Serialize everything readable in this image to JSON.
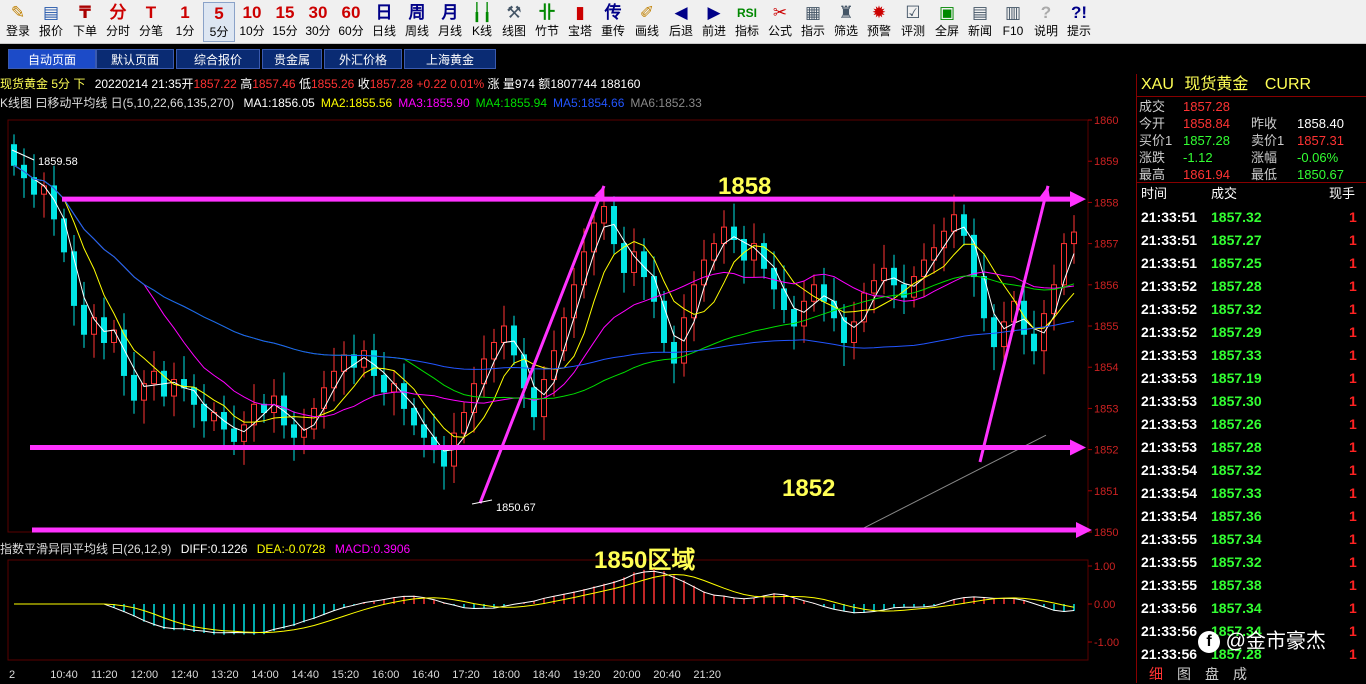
{
  "toolbar": [
    {
      "label": "登录",
      "icon": "login-icon",
      "glyph": "✎",
      "color": "#c08000"
    },
    {
      "label": "报价",
      "icon": "quote-icon",
      "glyph": "▤",
      "color": "#2255aa"
    },
    {
      "label": "下单",
      "icon": "order-icon",
      "glyph": "₸",
      "color": "#aa0000"
    },
    {
      "label": "分时",
      "icon": "timeshare-icon",
      "glyph": "分",
      "color": "#cc0000"
    },
    {
      "label": "分笔",
      "icon": "tick-icon",
      "glyph": "T",
      "color": "#cc0000"
    },
    {
      "label": "1分",
      "icon": "period-1m-icon",
      "glyph": "1",
      "color": "#cc0000"
    },
    {
      "label": "5分",
      "icon": "period-5m-icon",
      "glyph": "5",
      "color": "#cc0000"
    },
    {
      "label": "10分",
      "icon": "period-10m-icon",
      "glyph": "10",
      "color": "#cc0000"
    },
    {
      "label": "15分",
      "icon": "period-15m-icon",
      "glyph": "15",
      "color": "#cc0000"
    },
    {
      "label": "30分",
      "icon": "period-30m-icon",
      "glyph": "30",
      "color": "#cc0000"
    },
    {
      "label": "60分",
      "icon": "period-60m-icon",
      "glyph": "60",
      "color": "#cc0000"
    },
    {
      "label": "日线",
      "icon": "daily-icon",
      "glyph": "日",
      "color": "#000088"
    },
    {
      "label": "周线",
      "icon": "weekly-icon",
      "glyph": "周",
      "color": "#000088"
    },
    {
      "label": "月线",
      "icon": "monthly-icon",
      "glyph": "月",
      "color": "#000088"
    },
    {
      "label": "K线",
      "icon": "kline-icon",
      "glyph": "╽╽",
      "color": "#008800"
    },
    {
      "label": "线图",
      "icon": "line-chart-icon",
      "glyph": "⚒",
      "color": "#445566"
    },
    {
      "label": "竹节",
      "icon": "bamboo-icon",
      "glyph": "卝",
      "color": "#008800"
    },
    {
      "label": "宝塔",
      "icon": "pagoda-icon",
      "glyph": "▮",
      "color": "#cc0000"
    },
    {
      "label": "重传",
      "icon": "resend-icon",
      "glyph": "传",
      "color": "#000088"
    },
    {
      "label": "画线",
      "icon": "draw-line-icon",
      "glyph": "✐",
      "color": "#c08000"
    },
    {
      "label": "后退",
      "icon": "back-icon",
      "glyph": "◀",
      "color": "#000088"
    },
    {
      "label": "前进",
      "icon": "forward-icon",
      "glyph": "▶",
      "color": "#000088"
    },
    {
      "label": "指标",
      "icon": "rsi-icon",
      "glyph": "RSI",
      "color": "#008800"
    },
    {
      "label": "公式",
      "icon": "formula-icon",
      "glyph": "✂",
      "color": "#cc0000"
    },
    {
      "label": "指示",
      "icon": "indicator-icon",
      "glyph": "▦",
      "color": "#445566"
    },
    {
      "label": "筛选",
      "icon": "filter-icon",
      "glyph": "♜",
      "color": "#445566"
    },
    {
      "label": "预警",
      "icon": "alert-icon",
      "glyph": "✹",
      "color": "#cc0000"
    },
    {
      "label": "评测",
      "icon": "evaluate-icon",
      "glyph": "☑",
      "color": "#445566"
    },
    {
      "label": "全屏",
      "icon": "fullscreen-icon",
      "glyph": "▣",
      "color": "#008800"
    },
    {
      "label": "新闻",
      "icon": "news-icon",
      "glyph": "▤",
      "color": "#445566"
    },
    {
      "label": "F10",
      "icon": "f10-icon",
      "glyph": "▥",
      "color": "#445566"
    },
    {
      "label": "说明",
      "icon": "help-icon",
      "glyph": "?",
      "color": "#aaaaaa"
    },
    {
      "label": "提示",
      "icon": "tips-icon",
      "glyph": "?!",
      "color": "#000088"
    }
  ],
  "tabs": [
    "自动页面",
    "默认页面",
    "综合报价",
    "贵金属",
    "外汇价格",
    "上海黄金"
  ],
  "info": {
    "title": "现货黄金 5分 下",
    "date": "20220214 21:35",
    "open_label": "开",
    "open": "1857.22",
    "high_label": "高",
    "high": "1857.46",
    "low_label": "低",
    "low": "1855.26",
    "close_label": "收",
    "close": "1857.28",
    "change_label": "涨",
    "change": "+0.22",
    "change_pct": "0.01%",
    "volume_label": "量",
    "volume": "974",
    "amount_label": "额",
    "amount": "1807744",
    "extra": "188160"
  },
  "ma": {
    "label": "K线图 曰移动平均线 日(5,10,22,66,135,270)",
    "items": [
      {
        "text": "MA1:1856.05",
        "color": "#ffffff"
      },
      {
        "text": "MA2:1855.56",
        "color": "#ffff00"
      },
      {
        "text": "MA3:1855.90",
        "color": "#ff00ff"
      },
      {
        "text": "MA4:1855.94",
        "color": "#00dd00"
      },
      {
        "text": "MA5:1854.66",
        "color": "#2255ff"
      },
      {
        "text": "MA6:1852.33",
        "color": "#888888"
      }
    ]
  },
  "macd": {
    "label": "指数平滑异同平均线 曰(26,12,9)",
    "diff": "DIFF:0.1226",
    "dea": "DEA:-0.0728",
    "macd": "MACD:0.3906"
  },
  "chart_data": {
    "type": "candlestick",
    "y_axis": {
      "min": 1850,
      "max": 1860,
      "ticks": [
        "1860",
        "1859",
        "1858",
        "1857",
        "1856",
        "1855",
        "1854",
        "1853",
        "1852",
        "1851",
        "1850"
      ]
    },
    "x_ticks": [
      "2",
      "10:40",
      "11:20",
      "12:00",
      "12:40",
      "13:20",
      "14:00",
      "14:40",
      "15:20",
      "16:00",
      "16:40",
      "17:20",
      "18:00",
      "18:40",
      "19:20",
      "20:00",
      "20:40",
      "21:20"
    ],
    "annotations": {
      "high_marker": "1859.58",
      "low_marker": "1850.67",
      "level_1858": "1858",
      "level_1852": "1852",
      "zone_1850": "1850区域"
    },
    "macd_ticks": [
      "1.00",
      "0.00",
      "-1.00"
    ],
    "candle_closes": [
      1858.9,
      1858.6,
      1858.2,
      1858.4,
      1857.6,
      1856.8,
      1855.5,
      1854.8,
      1855.2,
      1854.6,
      1854.9,
      1853.8,
      1853.2,
      1853.6,
      1853.9,
      1853.3,
      1853.7,
      1853.5,
      1853.1,
      1852.7,
      1852.9,
      1852.5,
      1852.2,
      1852.6,
      1853.1,
      1852.9,
      1853.3,
      1852.6,
      1852.3,
      1852.5,
      1853.0,
      1853.5,
      1853.9,
      1854.3,
      1854.0,
      1854.4,
      1853.8,
      1853.4,
      1853.6,
      1853.0,
      1852.6,
      1852.3,
      1852.0,
      1851.6,
      1852.4,
      1852.9,
      1853.6,
      1854.2,
      1854.6,
      1855.0,
      1854.3,
      1853.5,
      1852.8,
      1853.7,
      1854.4,
      1855.2,
      1856.0,
      1856.8,
      1857.5,
      1857.9,
      1857.0,
      1856.3,
      1856.8,
      1856.2,
      1855.6,
      1854.6,
      1854.1,
      1855.2,
      1856.0,
      1856.6,
      1857.0,
      1857.4,
      1857.1,
      1856.6,
      1857.0,
      1856.4,
      1855.9,
      1855.4,
      1855.0,
      1855.6,
      1856.0,
      1855.6,
      1855.2,
      1854.6,
      1855.1,
      1855.8,
      1856.1,
      1856.4,
      1856.0,
      1855.7,
      1856.2,
      1856.6,
      1856.9,
      1857.3,
      1857.7,
      1857.2,
      1856.2,
      1855.2,
      1854.5,
      1855.1,
      1855.6,
      1854.8,
      1854.4,
      1855.3,
      1856.0,
      1857.0,
      1857.28
    ]
  },
  "quote": {
    "symbol": "XAU",
    "name": "现货黄金",
    "code": "CURR",
    "last_label": "成交",
    "last": "1857.28",
    "rows": [
      {
        "l1": "今开",
        "v1": "1858.84",
        "l2": "昨收",
        "v2": "1858.40"
      },
      {
        "l1": "买价1",
        "v1": "1857.28",
        "l2": "卖价1",
        "v2": "1857.31"
      },
      {
        "l1": "涨跌",
        "v1": "-1.12",
        "l2": "涨幅",
        "v2": "-0.06%"
      },
      {
        "l1": "最高",
        "v1": "1861.94",
        "l2": "最低",
        "v2": "1850.67"
      }
    ],
    "trades_header": {
      "time": "时间",
      "price": "成交",
      "qty": "现手"
    },
    "trades": [
      {
        "time": "21:33:51",
        "price": "1857.32",
        "qty": "1"
      },
      {
        "time": "21:33:51",
        "price": "1857.27",
        "qty": "1"
      },
      {
        "time": "21:33:51",
        "price": "1857.25",
        "qty": "1"
      },
      {
        "time": "21:33:52",
        "price": "1857.28",
        "qty": "1"
      },
      {
        "time": "21:33:52",
        "price": "1857.32",
        "qty": "1"
      },
      {
        "time": "21:33:52",
        "price": "1857.29",
        "qty": "1"
      },
      {
        "time": "21:33:53",
        "price": "1857.33",
        "qty": "1"
      },
      {
        "time": "21:33:53",
        "price": "1857.19",
        "qty": "1"
      },
      {
        "time": "21:33:53",
        "price": "1857.30",
        "qty": "1"
      },
      {
        "time": "21:33:53",
        "price": "1857.26",
        "qty": "1"
      },
      {
        "time": "21:33:53",
        "price": "1857.28",
        "qty": "1"
      },
      {
        "time": "21:33:54",
        "price": "1857.32",
        "qty": "1"
      },
      {
        "time": "21:33:54",
        "price": "1857.33",
        "qty": "1"
      },
      {
        "time": "21:33:54",
        "price": "1857.36",
        "qty": "1"
      },
      {
        "time": "21:33:55",
        "price": "1857.34",
        "qty": "1"
      },
      {
        "time": "21:33:55",
        "price": "1857.32",
        "qty": "1"
      },
      {
        "time": "21:33:55",
        "price": "1857.38",
        "qty": "1"
      },
      {
        "time": "21:33:56",
        "price": "1857.34",
        "qty": "1"
      },
      {
        "time": "21:33:56",
        "price": "1857.34",
        "qty": "1"
      },
      {
        "time": "21:33:56",
        "price": "1857.28",
        "qty": "1"
      }
    ],
    "bottom_tabs": [
      "细",
      "图",
      "盘",
      "成"
    ]
  },
  "watermark": "@金市豪杰",
  "colors": {
    "up": "#ff3333",
    "down": "#00e5e5",
    "grid": "#5a0000",
    "annot": "#ff33ff",
    "label": "#ffff55",
    "qty": "#ff2222",
    "price": "#33ff33"
  }
}
